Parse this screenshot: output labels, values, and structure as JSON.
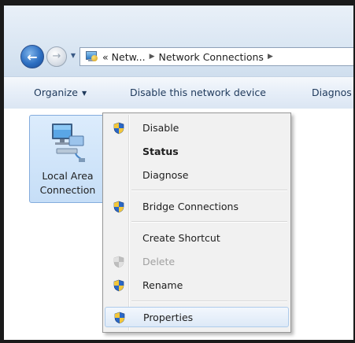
{
  "address_bar": {
    "overflow": "«",
    "segment1": "Netw...",
    "segment2": "Network Connections"
  },
  "toolbar": {
    "organize": "Organize",
    "disable_device": "Disable this network device",
    "diagnose_truncated": "Diagnos"
  },
  "connection": {
    "name_line1": "Local Area",
    "name_line2": "Connection"
  },
  "context_menu": {
    "items": [
      {
        "label": "Disable",
        "icon": "uac-shield-icon"
      },
      {
        "label": "Status",
        "bold": true
      },
      {
        "label": "Diagnose"
      },
      {
        "label": "Bridge Connections",
        "icon": "uac-shield-icon"
      },
      {
        "label": "Create Shortcut"
      },
      {
        "label": "Delete",
        "icon": "uac-shield-icon",
        "disabled": true
      },
      {
        "label": "Rename",
        "icon": "uac-shield-icon"
      },
      {
        "label": "Properties",
        "icon": "uac-shield-icon",
        "highlighted": true
      }
    ]
  },
  "colors": {
    "tile_selected": "#c6def7",
    "menu_highlight": "#dde9f7",
    "toolbar_text": "#1e395b"
  }
}
